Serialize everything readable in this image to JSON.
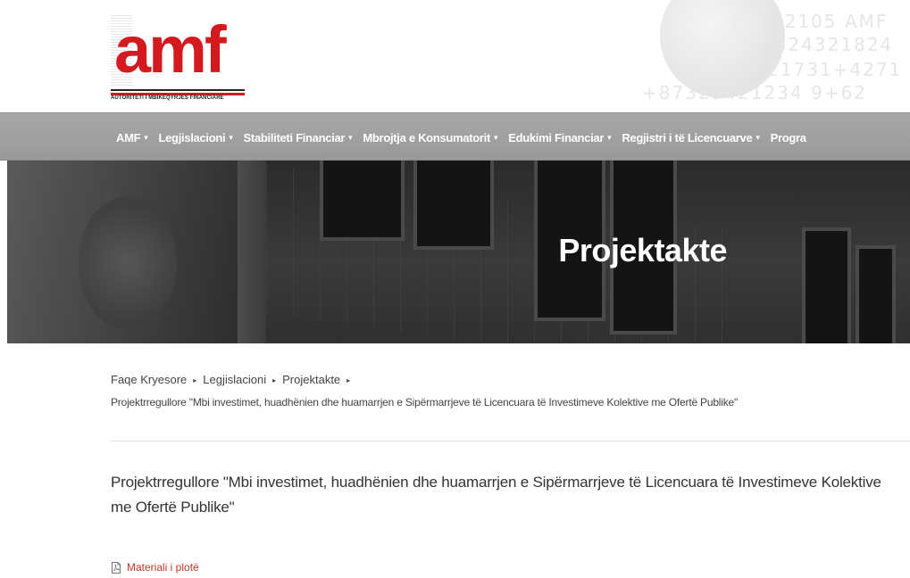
{
  "brand": {
    "logo_text": "amf",
    "tagline": "AUTORITETI I MBIKËQYRJES FINANCIARE",
    "accent_color": "#d41a1f"
  },
  "header_bg_digits": [
    "52105 AMF",
    "+324321824",
    "21731+4271",
    "+87329421234 9+62"
  ],
  "nav": {
    "items": [
      {
        "label": "AMF",
        "caret": "▾"
      },
      {
        "label": "Legjislacioni",
        "caret": "▾"
      },
      {
        "label": "Stabiliteti Financiar",
        "caret": "▾"
      },
      {
        "label": "Mbrojtja e Konsumatorit",
        "caret": "▾"
      },
      {
        "label": "Edukimi Financiar",
        "caret": "▾"
      },
      {
        "label": "Regjistri i të Licencuarve",
        "caret": "▾"
      },
      {
        "label": "Progra",
        "caret": ""
      }
    ]
  },
  "hero": {
    "title": "Projektakte"
  },
  "breadcrumb": {
    "items": [
      "Faqe Kryesore",
      "Legjislacioni",
      "Projektakte"
    ],
    "separator": "▸",
    "current": "Projektrregullore \"Mbi investimet, huadhënien dhe huamarrjen e Sipërmarrjeve të Licencuara të Investimeve Kolektive me Ofertë Publike\""
  },
  "article": {
    "title": "Projektrregullore \"Mbi investimet, huadhënien dhe huamarrjen e Sipërmarrjeve të Licencuara të Investimeve Kolektive me Ofertë Publike\""
  },
  "attachment": {
    "label": "Materiali i plotë",
    "icon": "pdf-file-icon"
  }
}
